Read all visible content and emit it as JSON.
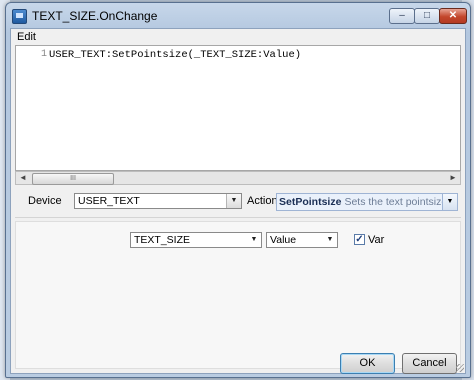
{
  "window": {
    "title": "TEXT_SIZE.OnChange"
  },
  "caption_buttons": {
    "minimize": "–",
    "maximize": "□",
    "close": "✕"
  },
  "menu": {
    "edit": "Edit"
  },
  "editor": {
    "line_number": "1",
    "code": "USER_TEXT:SetPointsize(_TEXT_SIZE:Value)"
  },
  "scrollbar": {
    "left_arrow": "◄",
    "right_arrow": "►",
    "thumb_grip": "III"
  },
  "form": {
    "device_label": "Device",
    "device_value": "USER_TEXT",
    "action_label": "Action",
    "action_name": "SetPointsize",
    "action_description": "Sets the text pointsize"
  },
  "params": {
    "source": "TEXT_SIZE",
    "property": "Value",
    "var_checked": true,
    "var_label": "Var"
  },
  "buttons": {
    "ok": "OK",
    "cancel": "Cancel"
  },
  "dropdown_glyph": "▼",
  "check_glyph": "✓"
}
